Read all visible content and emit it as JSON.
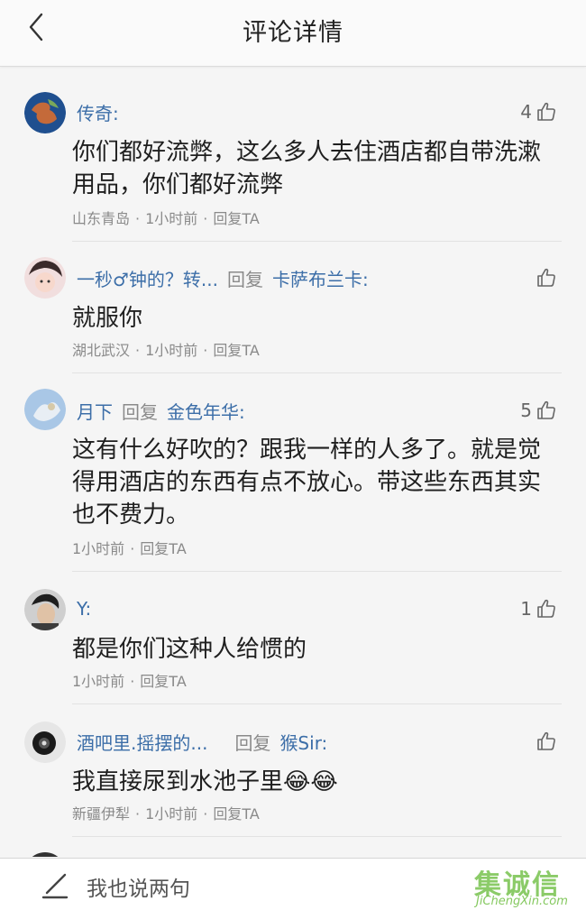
{
  "header": {
    "title": "评论详情",
    "back_icon": "chevron-left-icon"
  },
  "comments": [
    {
      "user": "传奇:",
      "reply_word": "",
      "reply_to": "",
      "likes": "4",
      "content": "你们都好流弊，这么多人去住酒店都自带洗漱用品，你们都好流弊",
      "location": "山东青岛",
      "time": "1小时前",
      "reply_action": "回复TA",
      "avatar_color": "#3b6fb0"
    },
    {
      "user": "一秒♂钟的？转...",
      "reply_word": "回复",
      "reply_to": "卡萨布兰卡:",
      "likes": "",
      "content": "就服你",
      "location": "湖北武汉",
      "time": "1小时前",
      "reply_action": "回复TA",
      "avatar_color": "#d9a3a3"
    },
    {
      "user": "月下",
      "reply_word": "回复",
      "reply_to": "金色年华:",
      "likes": "5",
      "content": "这有什么好吹的？跟我一样的人多了。就是觉得用酒店的东西有点不放心。带这些东西其实也不费力。",
      "location": "",
      "time": "1小时前",
      "reply_action": "回复TA",
      "avatar_color": "#8fb4d9"
    },
    {
      "user": "Y:",
      "reply_word": "",
      "reply_to": "",
      "likes": "1",
      "content": "都是你们这种人给惯的",
      "location": "",
      "time": "1小时前",
      "reply_action": "回复TA",
      "avatar_color": "#4a4a4a"
    },
    {
      "user": "酒吧里.摇摆的...",
      "reply_word": "回复",
      "reply_to": "猴Sir:",
      "likes": "",
      "content": "我直接尿到水池子里😂😂",
      "location": "新疆伊犁",
      "time": "1小时前",
      "reply_action": "回复TA",
      "avatar_color": "#2b2b2b"
    }
  ],
  "footer": {
    "placeholder": "我也说两句",
    "watermark_logo": "集诚信",
    "watermark_site": "JiChengXin.com"
  },
  "colors": {
    "username": "#3c6ea8",
    "meta": "#8a8a8a",
    "watermark": "#6fbf43"
  }
}
